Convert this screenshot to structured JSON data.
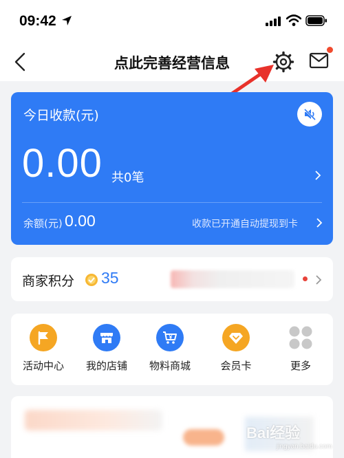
{
  "status_bar": {
    "time": "09:42"
  },
  "nav": {
    "title": "点此完善经营信息"
  },
  "income": {
    "label": "今日收款(元)",
    "amount": "0.00",
    "count_text": "共0笔",
    "balance_label": "余额(元)",
    "balance_value": "0.00",
    "withdraw_note": "收款已开通自动提现到卡"
  },
  "points": {
    "label": "商家积分",
    "value": "35"
  },
  "shortcuts": [
    {
      "label": "活动中心",
      "icon": "flag-icon",
      "color": "#f5a623"
    },
    {
      "label": "我的店铺",
      "icon": "store-icon",
      "color": "#2f7bf5"
    },
    {
      "label": "物料商城",
      "icon": "cart-icon",
      "color": "#2f7bf5"
    },
    {
      "label": "会员卡",
      "icon": "diamond-icon",
      "color": "#f5a623"
    },
    {
      "label": "更多",
      "icon": "grid-more-icon",
      "color": "#c8c8c8"
    }
  ],
  "watermark": {
    "main": "Bai经验",
    "sub": "jingyan.baidu.com"
  },
  "colors": {
    "primary": "#2f7bf5",
    "accent_orange": "#f5a623",
    "badge_red": "#f04a2e",
    "page_bg": "#f2f3f5"
  }
}
